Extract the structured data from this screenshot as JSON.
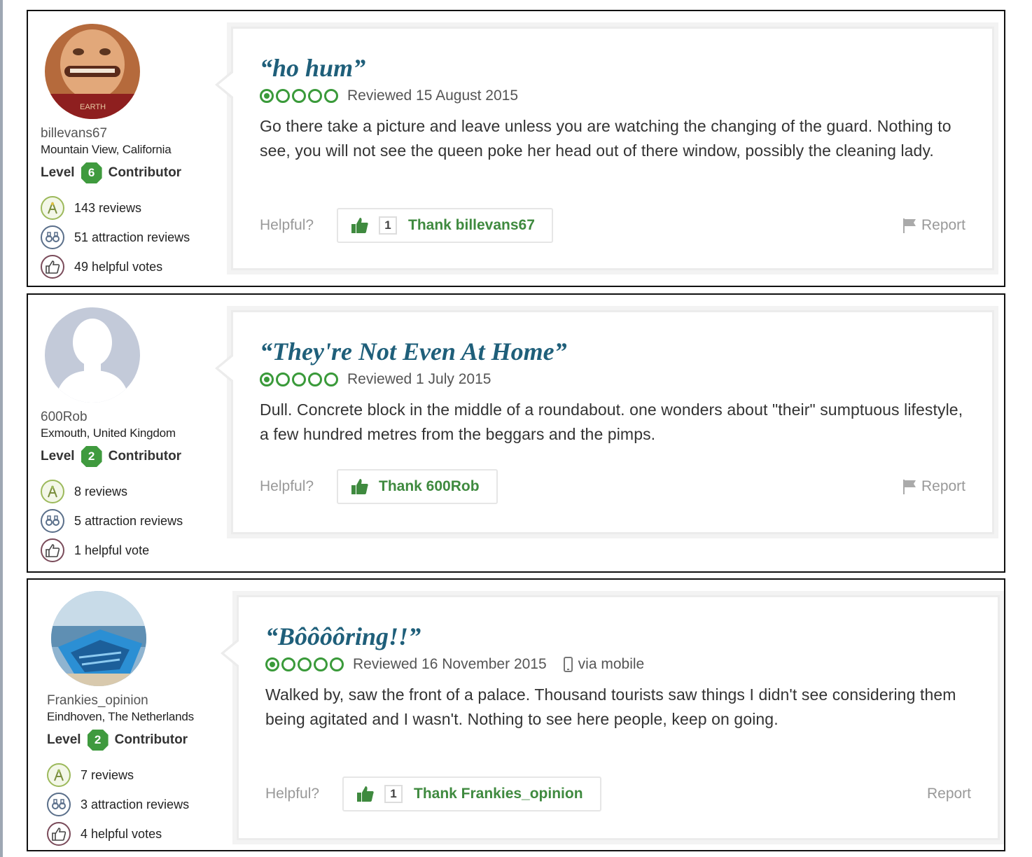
{
  "reviews": [
    {
      "member": {
        "username": "billevans67",
        "location": "Mountain View, California",
        "level_prefix": "Level",
        "level": "6",
        "level_suffix": "Contributor",
        "reviews": "143 reviews",
        "attraction_reviews": "51 attraction reviews",
        "helpful_votes": "49 helpful votes"
      },
      "title": "“ho hum”",
      "rating": 1,
      "reviewed_date": "Reviewed 15 August 2015",
      "via": "",
      "text": "Go there take a picture and leave unless you are watching the changing of the guard. Nothing to see, you will not see the queen poke her head out of there window, possibly the cleaning lady.",
      "helpful_label": "Helpful?",
      "thank_count": "1",
      "thank_label": "Thank billevans67",
      "report_label": "Report"
    },
    {
      "member": {
        "username": "600Rob",
        "location": "Exmouth, United Kingdom",
        "level_prefix": "Level",
        "level": "2",
        "level_suffix": "Contributor",
        "reviews": "8 reviews",
        "attraction_reviews": "5 attraction reviews",
        "helpful_votes": "1 helpful vote"
      },
      "title": "“They're Not Even At Home”",
      "rating": 1,
      "reviewed_date": "Reviewed 1 July 2015",
      "via": "",
      "text": "Dull. Concrete block in the middle of a roundabout. one wonders about \"their\" sumptuous lifestyle, a few hundred metres from the beggars and the pimps.",
      "helpful_label": "Helpful?",
      "thank_count": "",
      "thank_label": "Thank 600Rob",
      "report_label": "Report"
    },
    {
      "member": {
        "username": "Frankies_opinion",
        "location": "Eindhoven, The Netherlands",
        "level_prefix": "Level",
        "level": "2",
        "level_suffix": "Contributor",
        "reviews": "7 reviews",
        "attraction_reviews": "3 attraction reviews",
        "helpful_votes": "4 helpful votes"
      },
      "title": "“Bôôôôring!!”",
      "rating": 1,
      "reviewed_date": "Reviewed 16 November 2015",
      "via": "via mobile",
      "text": "Walked by, saw the front of a palace. Thousand tourists saw things I didn't see considering them being agitated and I wasn't. Nothing to see here people, keep on going.",
      "helpful_label": "Helpful?",
      "thank_count": "1",
      "thank_label": "Thank Frankies_opinion",
      "report_label": "Report"
    }
  ],
  "colors": {
    "title": "#1f5f7a",
    "rating_green": "#3a9a3a",
    "thank_green": "#3f8a3f",
    "level_badge": "#3f9a3e"
  },
  "icons": {
    "reviews": "reviewer-badge-icon",
    "attractions": "binoculars-icon",
    "votes": "thumbs-up-outline-icon",
    "thank": "thumbs-up-icon",
    "report": "flag-icon",
    "mobile": "mobile-phone-icon"
  }
}
